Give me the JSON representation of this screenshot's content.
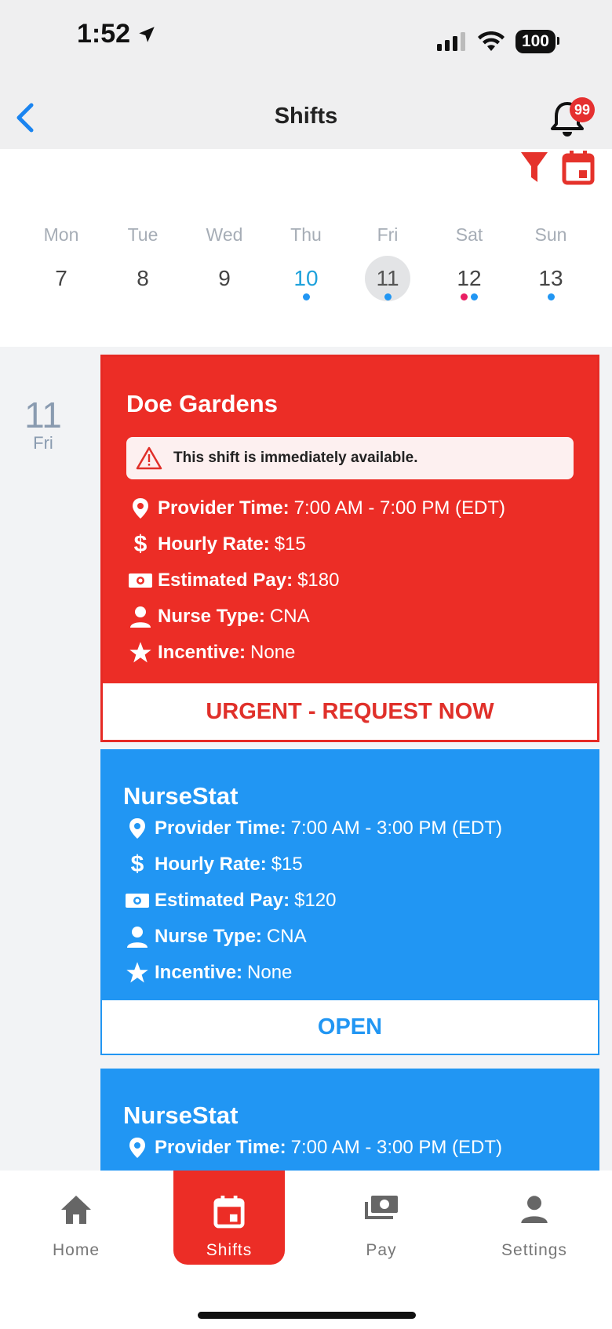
{
  "status": {
    "time": "1:52",
    "battery": "100"
  },
  "nav": {
    "title": "Shifts",
    "notification_count": "99"
  },
  "calendar": {
    "days": [
      {
        "name": "Mon",
        "num": "7"
      },
      {
        "name": "Tue",
        "num": "8"
      },
      {
        "name": "Wed",
        "num": "9"
      },
      {
        "name": "Thu",
        "num": "10"
      },
      {
        "name": "Fri",
        "num": "11"
      },
      {
        "name": "Sat",
        "num": "12"
      },
      {
        "name": "Sun",
        "num": "13"
      }
    ]
  },
  "list": {
    "date_num": "11",
    "date_day": "Fri",
    "cards": [
      {
        "title": "Doe Gardens",
        "alert": "This shift is immediately available.",
        "provider_label": "Provider Time:",
        "provider_value": "7:00 AM - 7:00 PM (EDT)",
        "rate_label": "Hourly Rate:",
        "rate_value": "$15",
        "pay_label": "Estimated Pay:",
        "pay_value": "$180",
        "type_label": "Nurse Type:",
        "type_value": "CNA",
        "incentive_label": "Incentive:",
        "incentive_value": "None",
        "button": "URGENT - REQUEST NOW"
      },
      {
        "title": "NurseStat",
        "provider_label": "Provider Time:",
        "provider_value": "7:00 AM - 3:00 PM (EDT)",
        "rate_label": "Hourly Rate:",
        "rate_value": "$15",
        "pay_label": "Estimated Pay:",
        "pay_value": "$120",
        "type_label": "Nurse Type:",
        "type_value": "CNA",
        "incentive_label": "Incentive:",
        "incentive_value": "None",
        "button": "OPEN"
      },
      {
        "title": "NurseStat",
        "provider_label": "Provider Time:",
        "provider_value": "7:00 AM - 3:00 PM (EDT)"
      }
    ]
  },
  "tabs": {
    "home": "Home",
    "shifts": "Shifts",
    "pay": "Pay",
    "settings": "Settings"
  },
  "colors": {
    "urgent": "#ec2d26",
    "open": "#2196f3",
    "today": "#1ea1db"
  }
}
